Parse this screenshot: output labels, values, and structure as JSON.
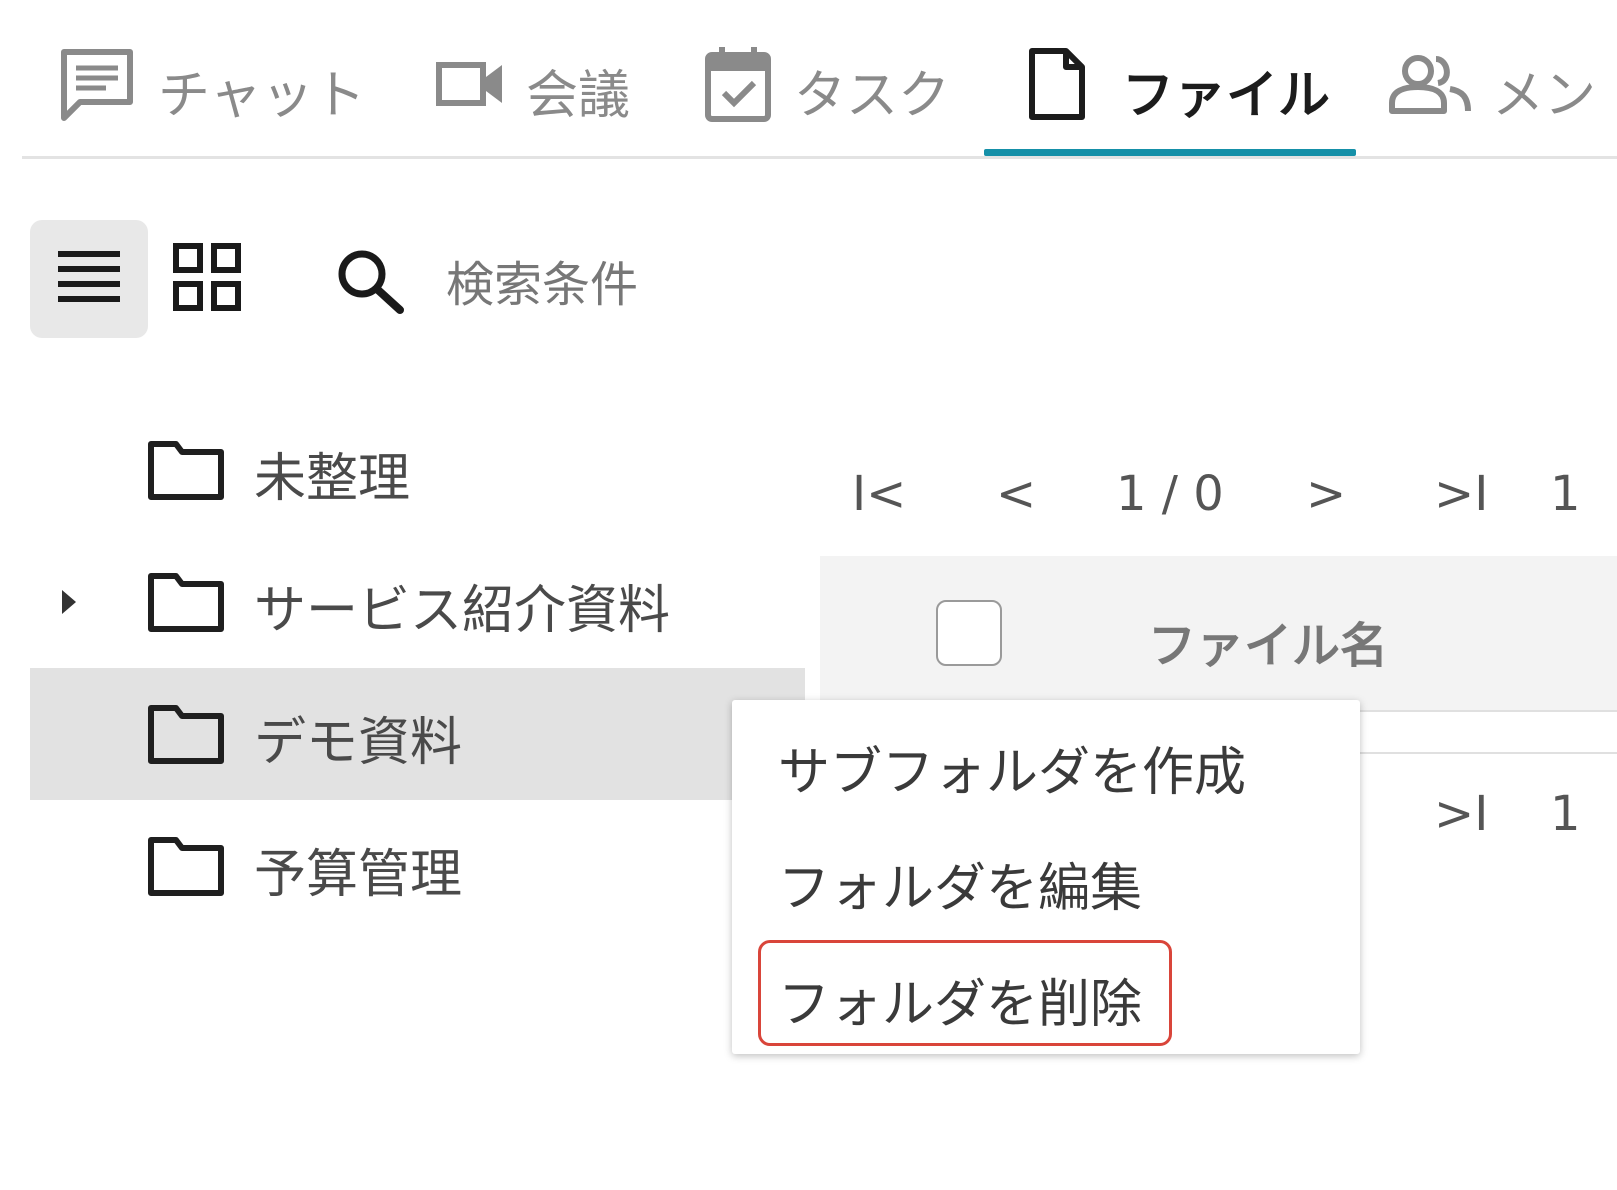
{
  "tabs": [
    {
      "label": "チャット",
      "icon": "chat-icon",
      "active": false
    },
    {
      "label": "会議",
      "icon": "video-icon",
      "active": false
    },
    {
      "label": "タスク",
      "icon": "calendar-check-icon",
      "active": false
    },
    {
      "label": "ファイル",
      "icon": "file-icon",
      "active": true
    },
    {
      "label": "メン",
      "icon": "members-icon",
      "active": false
    }
  ],
  "toolbar": {
    "list_view_icon": "list-view-icon",
    "grid_view_icon": "grid-view-icon",
    "search_icon": "search-icon",
    "search_label": "検索条件"
  },
  "folders": [
    {
      "label": "未整理",
      "expandable": false,
      "selected": false
    },
    {
      "label": "サービス紹介資料",
      "expandable": true,
      "selected": false
    },
    {
      "label": "デモ資料",
      "expandable": false,
      "selected": true
    },
    {
      "label": "予算管理",
      "expandable": false,
      "selected": false
    }
  ],
  "pager": {
    "first": "I<",
    "prev": "<",
    "page_info": "1 / 0",
    "next": ">",
    "last": ">I",
    "trailing": "1"
  },
  "table": {
    "column_filename": "ファイル名"
  },
  "bottom_pager": {
    "last": ">I",
    "trailing": "1"
  },
  "context_menu": {
    "items": [
      {
        "label": "サブフォルダを作成"
      },
      {
        "label": "フォルダを編集"
      },
      {
        "label": "フォルダを削除",
        "highlighted": true
      }
    ]
  },
  "colors": {
    "accent": "#1590a8",
    "selected_row": "#e2e2e2",
    "highlight_border": "#d9453a"
  }
}
